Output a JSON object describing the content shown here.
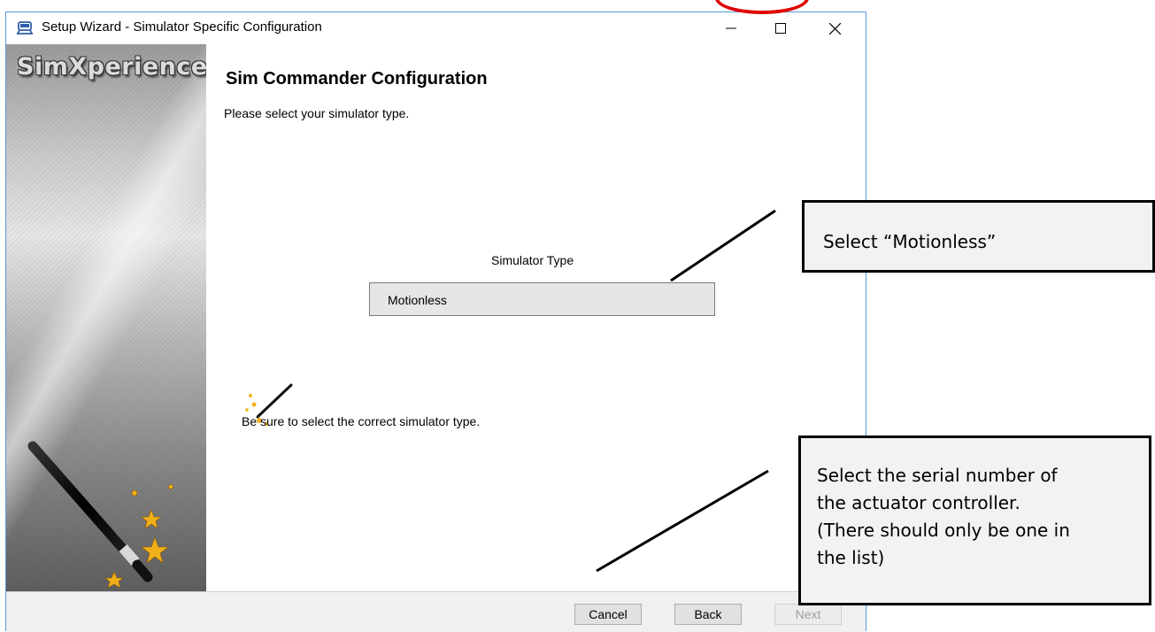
{
  "window": {
    "title": "Setup Wizard - Simulator Specific Configuration",
    "controls": {
      "minimize": "minimize",
      "maximize": "maximize",
      "close": "close"
    }
  },
  "sidebar": {
    "brand": "SimXperience"
  },
  "page": {
    "heading": "Sim Commander Configuration",
    "subtitle": "Please select your simulator type.",
    "simulator_type_label": "Simulator Type",
    "simulator_type_value": "Motionless",
    "hint": "Be sure to select the correct simulator type."
  },
  "footer": {
    "cancel": "Cancel",
    "back": "Back",
    "next": "Next"
  },
  "annotations": {
    "callout_motionless": "Select “Motionless”",
    "callout_serial": [
      "Select the serial number of",
      "the actuator controller.",
      "(There should only be one in",
      "the list)"
    ]
  },
  "colors": {
    "annotation_ring": "#e00000",
    "window_border": "#5b9bd5"
  }
}
